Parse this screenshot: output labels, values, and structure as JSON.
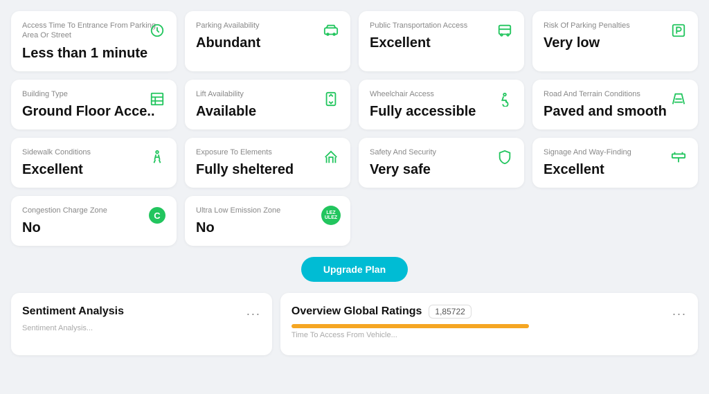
{
  "cards_row1": [
    {
      "label": "Access Time To Entrance From Parking Area Or Street",
      "value": "Less than 1 minute",
      "icon": "clock-icon"
    },
    {
      "label": "Parking Availability",
      "value": "Abundant",
      "icon": "car-icon"
    },
    {
      "label": "Public Transportation Access",
      "value": "Excellent",
      "icon": "bus-icon"
    },
    {
      "label": "Risk Of Parking Penalties",
      "value": "Very low",
      "icon": "parking-icon"
    }
  ],
  "cards_row2": [
    {
      "label": "Building Type",
      "value": "Ground Floor Acce..",
      "icon": "building-icon"
    },
    {
      "label": "Lift Availability",
      "value": "Available",
      "icon": "lift-icon"
    },
    {
      "label": "Wheelchair Access",
      "value": "Fully accessible",
      "icon": "wheelchair-icon"
    },
    {
      "label": "Road And Terrain Conditions",
      "value": "Paved and smooth",
      "icon": "road-icon"
    }
  ],
  "cards_row3": [
    {
      "label": "Sidewalk Conditions",
      "value": "Excellent",
      "icon": "walk-icon"
    },
    {
      "label": "Exposure To Elements",
      "value": "Fully sheltered",
      "icon": "shelter-icon"
    },
    {
      "label": "Safety And Security",
      "value": "Very safe",
      "icon": "shield-icon"
    },
    {
      "label": "Signage And Way-Finding",
      "value": "Excellent",
      "icon": "sign-icon"
    }
  ],
  "cards_row4": [
    {
      "label": "Congestion Charge Zone",
      "value": "No",
      "icon": "c-icon"
    },
    {
      "label": "Ultra Low Emission Zone",
      "value": "No",
      "icon": "ulez-icon"
    }
  ],
  "upgrade": {
    "button_label": "Upgrade Plan"
  },
  "sentiment": {
    "title": "Sentiment Analysis",
    "subtitle": "Sentiment Analysis...",
    "dots": "..."
  },
  "global_ratings": {
    "title": "Overview Global Ratings",
    "badge": "1,85722",
    "subtitle": "Time To Access From Vehicle...",
    "dots": "..."
  }
}
